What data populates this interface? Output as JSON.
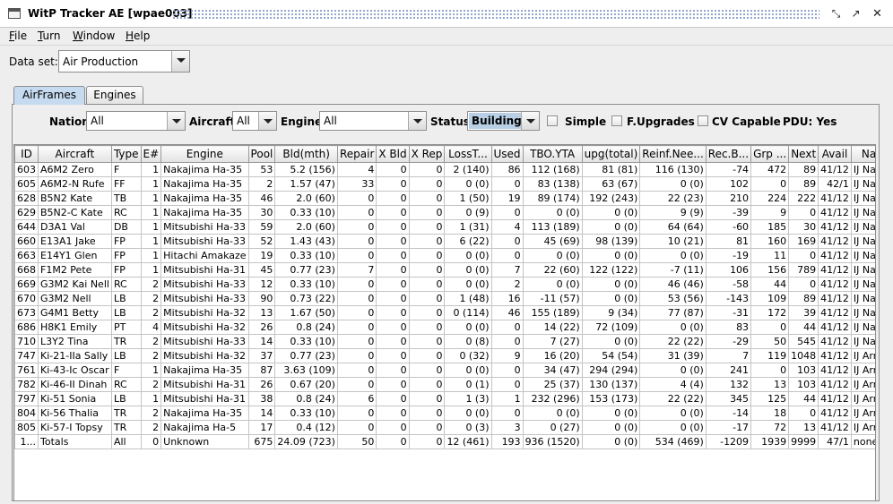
{
  "window": {
    "title": "WitP Tracker AE [wpae003]"
  },
  "menu": [
    {
      "key": "F",
      "rest": "ile"
    },
    {
      "key": "T",
      "rest": "urn"
    },
    {
      "key": "W",
      "rest": "indow"
    },
    {
      "key": "H",
      "rest": "elp"
    }
  ],
  "dataset": {
    "label": "Data set:",
    "value": "Air Production"
  },
  "tabs": {
    "airframes": "AirFrames",
    "engines": "Engines"
  },
  "filters": {
    "nation_label": "Nation:",
    "nation_value": "All",
    "aircraft_label": "Aircraft:",
    "aircraft_value": "All",
    "engine_label": "Engine:",
    "engine_value": "All",
    "status_label": "Status:",
    "status_value": "Building",
    "simple_label": "Simple",
    "fupgrades_label": "F.Upgrades",
    "cvcapable_label": "CV Capable",
    "pdu_label": "PDU: Yes"
  },
  "table": {
    "columns": [
      "ID",
      "Aircraft",
      "Type",
      "E#",
      "Engine",
      "Pool",
      "Bld(mth)",
      "Repair",
      "X Bld",
      "X Rep",
      "LossT...",
      "Used",
      "TBO.YTA",
      "upg(total)",
      "Reinf.Nee...",
      "Rec.B...",
      "Grp ...",
      "Next",
      "Avail",
      "Nat"
    ],
    "rows": [
      [
        "603",
        "A6M2 Zero",
        "F",
        "1",
        "Nakajima Ha-35",
        "53",
        "5.2 (156)",
        "4",
        "0",
        "0",
        "2 (140)",
        "86",
        "112 (168)",
        "81 (81)",
        "116 (130)",
        "-74",
        "472",
        "89",
        "41/12",
        "IJ Navy"
      ],
      [
        "605",
        "A6M2-N Rufe",
        "FF",
        "1",
        "Nakajima Ha-35",
        "2",
        "1.57 (47)",
        "33",
        "0",
        "0",
        "0 (0)",
        "0",
        "83 (138)",
        "63 (67)",
        "0 (0)",
        "102",
        "0",
        "89",
        "42/1",
        "IJ Navy"
      ],
      [
        "628",
        "B5N2 Kate",
        "TB",
        "1",
        "Nakajima Ha-35",
        "46",
        "2.0 (60)",
        "0",
        "0",
        "0",
        "1 (50)",
        "19",
        "89 (174)",
        "192 (243)",
        "22 (23)",
        "210",
        "224",
        "222",
        "41/12",
        "IJ Navy"
      ],
      [
        "629",
        "B5N2-C Kate",
        "RC",
        "1",
        "Nakajima Ha-35",
        "30",
        "0.33 (10)",
        "0",
        "0",
        "0",
        "0 (9)",
        "0",
        "0 (0)",
        "0 (0)",
        "9 (9)",
        "-39",
        "9",
        "0",
        "41/12",
        "IJ Navy"
      ],
      [
        "644",
        "D3A1 Val",
        "DB",
        "1",
        "Mitsubishi Ha-33",
        "59",
        "2.0 (60)",
        "0",
        "0",
        "0",
        "1 (31)",
        "4",
        "113 (189)",
        "0 (0)",
        "64 (64)",
        "-60",
        "185",
        "30",
        "41/12",
        "IJ Navy"
      ],
      [
        "660",
        "E13A1 Jake",
        "FP",
        "1",
        "Mitsubishi Ha-33",
        "52",
        "1.43 (43)",
        "0",
        "0",
        "0",
        "6 (22)",
        "0",
        "45 (69)",
        "98 (139)",
        "10 (21)",
        "81",
        "160",
        "169",
        "41/12",
        "IJ Navy"
      ],
      [
        "663",
        "E14Y1 Glen",
        "FP",
        "1",
        "Hitachi Amakaze",
        "19",
        "0.33 (10)",
        "0",
        "0",
        "0",
        "0 (0)",
        "0",
        "0 (0)",
        "0 (0)",
        "0 (0)",
        "-19",
        "11",
        "0",
        "41/12",
        "IJ Navy"
      ],
      [
        "668",
        "F1M2 Pete",
        "FP",
        "1",
        "Mitsubishi Ha-31",
        "45",
        "0.77 (23)",
        "7",
        "0",
        "0",
        "0 (0)",
        "7",
        "22 (60)",
        "122 (122)",
        "-7 (11)",
        "106",
        "156",
        "789",
        "41/12",
        "IJ Navy"
      ],
      [
        "669",
        "G3M2 Kai Nell",
        "RC",
        "2",
        "Mitsubishi Ha-33",
        "12",
        "0.33 (10)",
        "0",
        "0",
        "0",
        "0 (0)",
        "2",
        "0 (0)",
        "0 (0)",
        "46 (46)",
        "-58",
        "44",
        "0",
        "41/12",
        "IJ Navy"
      ],
      [
        "670",
        "G3M2 Nell",
        "LB",
        "2",
        "Mitsubishi Ha-33",
        "90",
        "0.73 (22)",
        "0",
        "0",
        "0",
        "1 (48)",
        "16",
        "-11 (57)",
        "0 (0)",
        "53 (56)",
        "-143",
        "109",
        "89",
        "41/12",
        "IJ Navy"
      ],
      [
        "673",
        "G4M1 Betty",
        "LB",
        "2",
        "Mitsubishi Ha-32",
        "13",
        "1.67 (50)",
        "0",
        "0",
        "0",
        "0 (114)",
        "46",
        "155 (189)",
        "9 (34)",
        "77 (87)",
        "-31",
        "172",
        "39",
        "41/12",
        "IJ Navy"
      ],
      [
        "686",
        "H8K1 Emily",
        "PT",
        "4",
        "Mitsubishi Ha-32",
        "26",
        "0.8 (24)",
        "0",
        "0",
        "0",
        "0 (0)",
        "0",
        "14 (22)",
        "72 (109)",
        "0 (0)",
        "83",
        "0",
        "44",
        "41/12",
        "IJ Navy"
      ],
      [
        "710",
        "L3Y2 Tina",
        "TR",
        "2",
        "Mitsubishi Ha-33",
        "14",
        "0.33 (10)",
        "0",
        "0",
        "0",
        "0 (8)",
        "0",
        "7 (27)",
        "0 (0)",
        "22 (22)",
        "-29",
        "50",
        "545",
        "41/12",
        "IJ Navy"
      ],
      [
        "747",
        "Ki-21-IIa Sally",
        "LB",
        "2",
        "Mitsubishi Ha-32",
        "37",
        "0.77 (23)",
        "0",
        "0",
        "0",
        "0 (32)",
        "9",
        "16 (20)",
        "54 (54)",
        "31 (39)",
        "7",
        "119",
        "1048",
        "41/12",
        "IJ Army"
      ],
      [
        "761",
        "Ki-43-Ic Oscar",
        "F",
        "1",
        "Nakajima Ha-35",
        "87",
        "3.63 (109)",
        "0",
        "0",
        "0",
        "0 (0)",
        "0",
        "34 (47)",
        "294 (294)",
        "0 (0)",
        "241",
        "0",
        "103",
        "41/12",
        "IJ Army"
      ],
      [
        "782",
        "Ki-46-II Dinah",
        "RC",
        "2",
        "Mitsubishi Ha-31",
        "26",
        "0.67 (20)",
        "0",
        "0",
        "0",
        "0 (1)",
        "0",
        "25 (37)",
        "130 (137)",
        "4 (4)",
        "132",
        "13",
        "103",
        "41/12",
        "IJ Army"
      ],
      [
        "797",
        "Ki-51 Sonia",
        "LB",
        "1",
        "Mitsubishi Ha-31",
        "38",
        "0.8 (24)",
        "6",
        "0",
        "0",
        "1 (3)",
        "1",
        "232 (296)",
        "153 (173)",
        "22 (22)",
        "345",
        "125",
        "44",
        "41/12",
        "IJ Army"
      ],
      [
        "804",
        "Ki-56 Thalia",
        "TR",
        "2",
        "Nakajima Ha-35",
        "14",
        "0.33 (10)",
        "0",
        "0",
        "0",
        "0 (0)",
        "0",
        "0 (0)",
        "0 (0)",
        "0 (0)",
        "-14",
        "18",
        "0",
        "41/12",
        "IJ Army"
      ],
      [
        "805",
        "Ki-57-I Topsy",
        "TR",
        "2",
        "Nakajima Ha-5",
        "17",
        "0.4 (12)",
        "0",
        "0",
        "0",
        "0 (3)",
        "3",
        "0 (27)",
        "0 (0)",
        "0 (0)",
        "-17",
        "72",
        "13",
        "41/12",
        "IJ Army"
      ],
      [
        "1...",
        "Totals",
        "All",
        "0",
        "Unknown",
        "675",
        "24.09 (723)",
        "50",
        "0",
        "0",
        "12 (461)",
        "193",
        "936 (1520)",
        "0 (0)",
        "534 (469)",
        "-1209",
        "1939",
        "9999",
        "47/1",
        "none"
      ]
    ]
  }
}
